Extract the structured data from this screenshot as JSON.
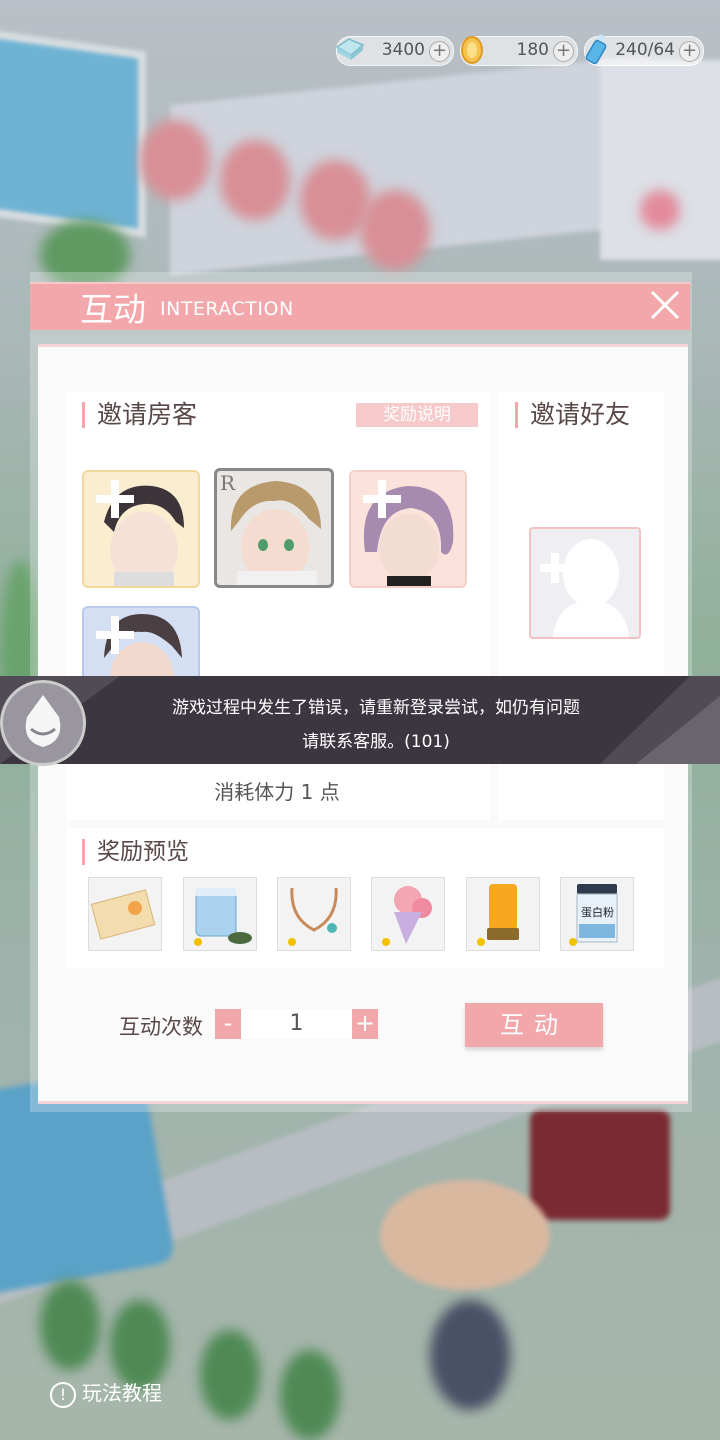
{
  "currencies": [
    {
      "icon": "diamond-icon",
      "value": "3400",
      "plus": "+"
    },
    {
      "icon": "gold-coin-icon",
      "value": "180",
      "plus": "+"
    },
    {
      "icon": "stamina-bottle-icon",
      "value": "240/64",
      "plus": "+"
    }
  ],
  "dialog": {
    "title": "互动",
    "subtitle": "INTERACTION",
    "close_icon": "close-icon"
  },
  "invite_guests": {
    "title": "邀请房客",
    "reward_info": "奖励说明",
    "rarity_badge": "R",
    "stamina_cost": "消耗体力 1 点"
  },
  "invite_friends": {
    "title": "邀请好友"
  },
  "rewards": {
    "title": "奖励预览",
    "items": [
      "ticket-card-icon",
      "jelly-jar-icon",
      "necklace-icon",
      "flower-bouquet-icon",
      "lamp-icon",
      "protein-powder-icon"
    ],
    "protein_label": "蛋白粉"
  },
  "interaction_count": {
    "label": "互动次数",
    "minus": "-",
    "value": "1",
    "plus": "+"
  },
  "action_button": "互动",
  "error_toast": {
    "line1": "游戏过程中发生了错误，请重新登录尝试，如仍有问题",
    "line2": "请联系客服。(101)"
  },
  "tutorial": {
    "icon_text": "!",
    "label": "玩法教程"
  },
  "colors": {
    "accent_pink": "#f2a7ab",
    "toast_bg": "#3b3640"
  }
}
